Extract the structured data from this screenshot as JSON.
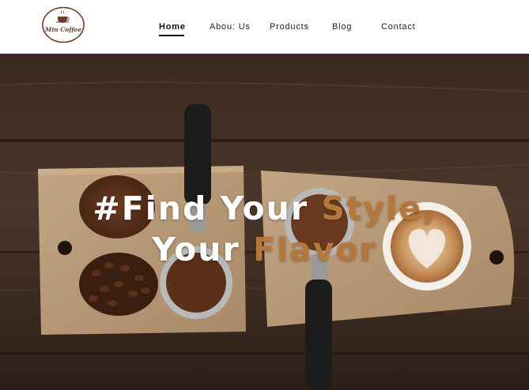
{
  "brand": {
    "logo_text": "Min Coffee",
    "logo_icon": "coffee-cup-icon"
  },
  "nav": {
    "items": [
      {
        "label": "Home",
        "active": true
      },
      {
        "label": "Abou: Us",
        "active": false
      },
      {
        "label": "Products",
        "active": false
      },
      {
        "label": "Blog",
        "active": false
      },
      {
        "label": "Contact",
        "active": false
      }
    ]
  },
  "hero": {
    "line1_white": "#Find Your ",
    "line1_accent": "Style,",
    "line2_white": "Your ",
    "line2_accent": "Flavor"
  },
  "colors": {
    "accent": "#b5773a",
    "wood_dark": "#3a2a20",
    "board": "#b89c7a"
  }
}
